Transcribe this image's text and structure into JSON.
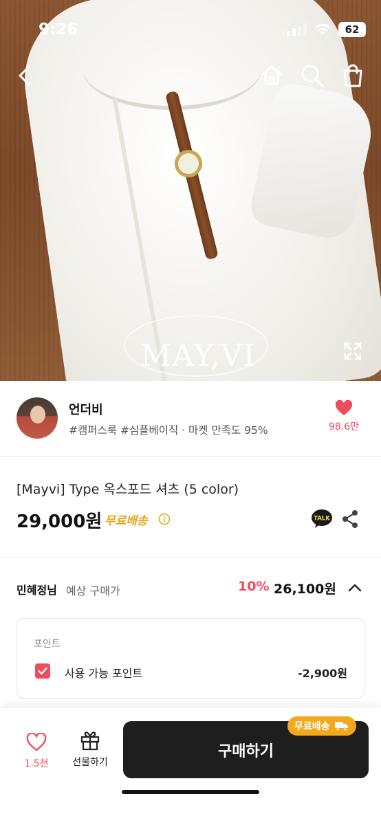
{
  "status_bar": {
    "time": "9:26",
    "battery": "62"
  },
  "hero": {
    "watermark": "MAY,VI"
  },
  "seller": {
    "name": "언더비",
    "tags": "#캠퍼스룩 #심플베이직 · 마켓 만족도 95%",
    "like_count": "98.6만"
  },
  "product": {
    "title": "[Mayvi] Type 옥스포드 셔츠 (5 color)",
    "price": "29,000원",
    "free_shipping": "무료배송",
    "talk_label": "TALK"
  },
  "expected_price": {
    "user": "민혜정님",
    "label": "예상 구매가",
    "discount": "10%",
    "price": "26,100원"
  },
  "points": {
    "header": "포인트",
    "label": "사용 가능 포인트",
    "value": "-2,900원",
    "checked": true
  },
  "bottom_bar": {
    "like_count": "1.5천",
    "gift_label": "선물하기",
    "buy_label": "구매하기",
    "free_shipping_badge": "무료배송"
  },
  "colors": {
    "accent_red": "#f04c5c",
    "accent_yellow": "#e6a615",
    "button_dark": "#1e1e1e"
  }
}
